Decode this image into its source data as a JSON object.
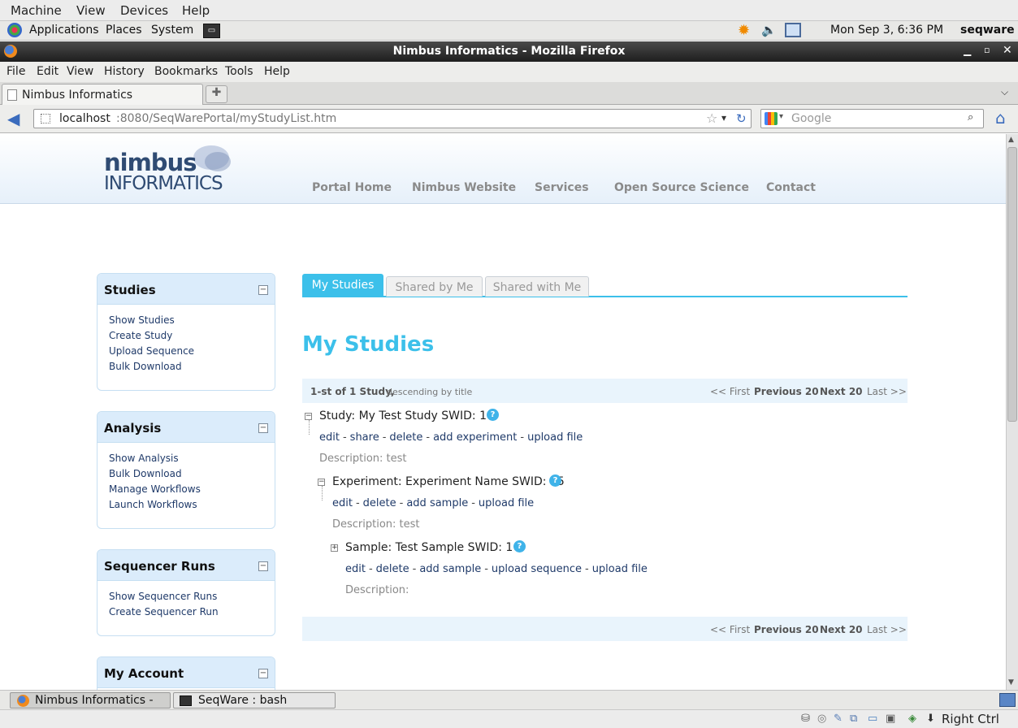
{
  "vbox_menu": [
    "Machine",
    "View",
    "Devices",
    "Help"
  ],
  "gnome_panel": {
    "applications": "Applications",
    "places": "Places",
    "system": "System",
    "clock": "Mon Sep  3,  6:36 PM",
    "user": "seqware"
  },
  "window": {
    "title": "Nimbus Informatics - Mozilla Firefox"
  },
  "ff_menu": [
    "File",
    "Edit",
    "View",
    "History",
    "Bookmarks",
    "Tools",
    "Help"
  ],
  "tab": {
    "label": "Nimbus Informatics"
  },
  "address": {
    "host": "localhost",
    "path": ":8080/SeqWarePortal/myStudyList.htm"
  },
  "search": {
    "placeholder": "Google"
  },
  "site": {
    "logo_top": "nimbus",
    "logo_bottom": "INFORMATICS",
    "nav": [
      "Portal Home",
      "Nimbus Website",
      "Services",
      "Open Source Science",
      "Contact"
    ]
  },
  "sidebar": [
    {
      "title": "Studies",
      "links": [
        "Show Studies",
        "Create Study",
        "Upload Sequence",
        "Bulk Download"
      ]
    },
    {
      "title": "Analysis",
      "links": [
        "Show Analysis",
        "Bulk Download",
        "Manage Workflows",
        "Launch Workflows"
      ]
    },
    {
      "title": "Sequencer Runs",
      "links": [
        "Show Sequencer Runs",
        "Create Sequencer Run"
      ]
    },
    {
      "title": "My Account",
      "links": []
    }
  ],
  "study_tabs": [
    "My Studies",
    "Shared by Me",
    "Shared with Me"
  ],
  "heading": "My Studies",
  "pager": {
    "count": "1-st of 1 Study,",
    "sort": "descending by title",
    "first": "<< First",
    "prev": "Previous 20",
    "next": "Next 20",
    "last": "Last >>"
  },
  "study": {
    "title": "Study: My Test Study SWID: 14",
    "actions": [
      "edit",
      "share",
      "delete",
      "add experiment",
      "upload file"
    ],
    "description": "Description: test"
  },
  "experiment": {
    "title": "Experiment: Experiment Name SWID: 15",
    "actions": [
      "edit",
      "delete",
      "add sample",
      "upload file"
    ],
    "description": "Description: test"
  },
  "sample": {
    "title": "Sample: Test Sample SWID: 16",
    "actions": [
      "edit",
      "delete",
      "add sample",
      "upload sequence",
      "upload file"
    ],
    "description": "Description:"
  },
  "taskbar": [
    "Nimbus Informatics - ...",
    "SeqWare : bash"
  ],
  "vbox_status": {
    "host_key": "Right Ctrl"
  },
  "colors": {
    "accent": "#3cc0ea",
    "link": "#1f3a69",
    "panel": "#dbecfb"
  }
}
